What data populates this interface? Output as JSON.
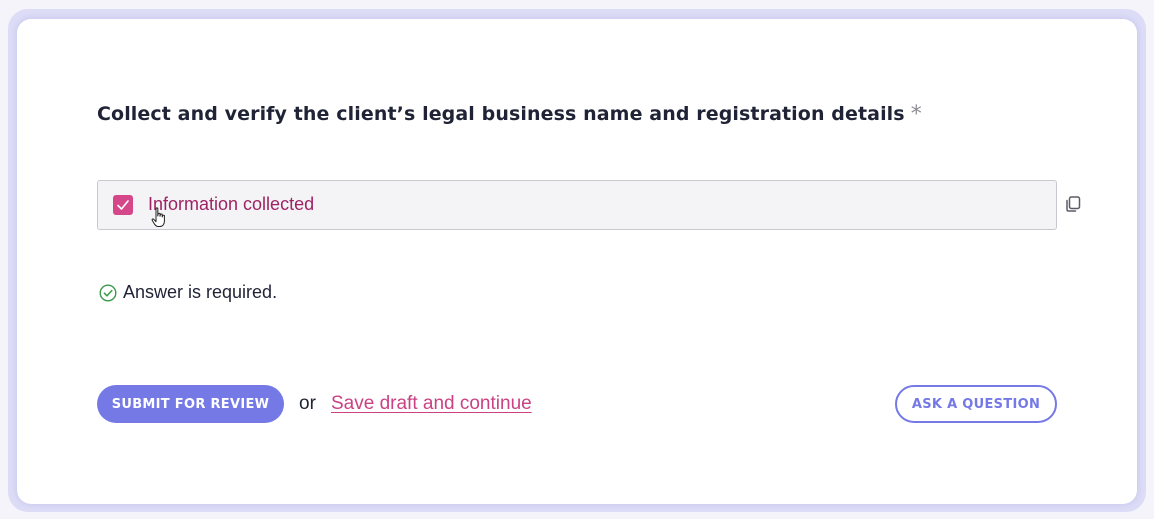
{
  "question": {
    "text": "Collect and verify the client’s legal business name and registration details",
    "required_mark": "*"
  },
  "answer": {
    "checked": true,
    "label": "Information collected"
  },
  "validation": {
    "message": "Answer is required."
  },
  "actions": {
    "submit_label": "SUBMIT FOR REVIEW",
    "or_text": "or",
    "draft_label": "Save draft and continue",
    "ask_label": "ASK A QUESTION"
  },
  "colors": {
    "accent": "#7479e6",
    "checkbox": "#d6478a",
    "link": "#c94283",
    "success": "#3a9a4a"
  },
  "icons": {
    "copy": "copy-icon",
    "validation": "check-circle-icon",
    "cursor": "hand-cursor-icon"
  }
}
